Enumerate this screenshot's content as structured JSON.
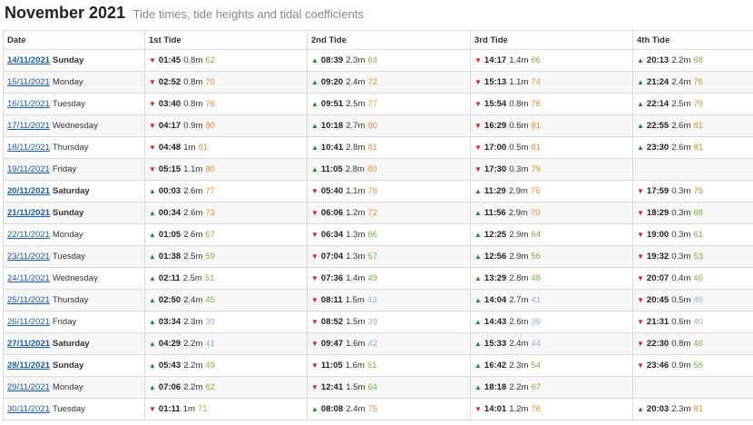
{
  "title": "November 2021",
  "subtitle": "Tide times, tide heights and tidal coefficients",
  "columns": [
    "Date",
    "1st Tide",
    "2nd Tide",
    "3rd Tide",
    "4th Tide"
  ],
  "colors": {
    "coef_high": "#7cb342",
    "coef_mid": "#e69138",
    "coef_low": "#8fb3d9",
    "up": "#1b8a2f",
    "down": "#d42020",
    "link": "#1a5fa8"
  },
  "rows": [
    {
      "date": "14/11/2021",
      "weekday": "Sunday",
      "bold": true,
      "tides": [
        {
          "dir": "down",
          "time": "01:45",
          "height": "0.8m",
          "coef": "62"
        },
        {
          "dir": "up",
          "time": "08:39",
          "height": "2.3m",
          "coef": "64"
        },
        {
          "dir": "down",
          "time": "14:17",
          "height": "1.4m",
          "coef": "66"
        },
        {
          "dir": "up",
          "time": "20:13",
          "height": "2.2m",
          "coef": "68"
        }
      ]
    },
    {
      "date": "15/11/2021",
      "weekday": "Monday",
      "bold": false,
      "tides": [
        {
          "dir": "down",
          "time": "02:52",
          "height": "0.8m",
          "coef": "70"
        },
        {
          "dir": "up",
          "time": "09:20",
          "height": "2.4m",
          "coef": "72"
        },
        {
          "dir": "down",
          "time": "15:13",
          "height": "1.1m",
          "coef": "74"
        },
        {
          "dir": "up",
          "time": "21:24",
          "height": "2.4m",
          "coef": "75"
        }
      ]
    },
    {
      "date": "16/11/2021",
      "weekday": "Tuesday",
      "bold": false,
      "tides": [
        {
          "dir": "down",
          "time": "03:40",
          "height": "0.8m",
          "coef": "76"
        },
        {
          "dir": "up",
          "time": "09:51",
          "height": "2.5m",
          "coef": "77"
        },
        {
          "dir": "down",
          "time": "15:54",
          "height": "0.8m",
          "coef": "78"
        },
        {
          "dir": "up",
          "time": "22:14",
          "height": "2.5m",
          "coef": "79"
        }
      ]
    },
    {
      "date": "17/11/2021",
      "weekday": "Wednesday",
      "bold": false,
      "tides": [
        {
          "dir": "down",
          "time": "04:17",
          "height": "0.9m",
          "coef": "80"
        },
        {
          "dir": "up",
          "time": "10:18",
          "height": "2.7m",
          "coef": "80"
        },
        {
          "dir": "down",
          "time": "16:29",
          "height": "0.6m",
          "coef": "81"
        },
        {
          "dir": "up",
          "time": "22:55",
          "height": "2.6m",
          "coef": "81"
        }
      ]
    },
    {
      "date": "18/11/2021",
      "weekday": "Thursday",
      "bold": false,
      "tides": [
        {
          "dir": "down",
          "time": "04:48",
          "height": "1m",
          "coef": "81"
        },
        {
          "dir": "up",
          "time": "10:41",
          "height": "2.8m",
          "coef": "81"
        },
        {
          "dir": "down",
          "time": "17:00",
          "height": "0.5m",
          "coef": "81"
        },
        {
          "dir": "up",
          "time": "23:30",
          "height": "2.6m",
          "coef": "81"
        }
      ]
    },
    {
      "date": "19/11/2021",
      "weekday": "Friday",
      "bold": false,
      "tides": [
        {
          "dir": "down",
          "time": "05:15",
          "height": "1.1m",
          "coef": "80"
        },
        {
          "dir": "up",
          "time": "11:05",
          "height": "2.8m",
          "coef": "80"
        },
        {
          "dir": "down",
          "time": "17:30",
          "height": "0.3m",
          "coef": "79"
        },
        null
      ]
    },
    {
      "date": "20/11/2021",
      "weekday": "Saturday",
      "bold": true,
      "tides": [
        {
          "dir": "up",
          "time": "00:03",
          "height": "2.6m",
          "coef": "77"
        },
        {
          "dir": "down",
          "time": "05:40",
          "height": "1.1m",
          "coef": "76"
        },
        {
          "dir": "up",
          "time": "11:29",
          "height": "2.9m",
          "coef": "76"
        },
        {
          "dir": "down",
          "time": "17:59",
          "height": "0.3m",
          "coef": "75"
        }
      ]
    },
    {
      "date": "21/11/2021",
      "weekday": "Sunday",
      "bold": true,
      "tides": [
        {
          "dir": "up",
          "time": "00:34",
          "height": "2.6m",
          "coef": "73"
        },
        {
          "dir": "down",
          "time": "06:06",
          "height": "1.2m",
          "coef": "72"
        },
        {
          "dir": "up",
          "time": "11:56",
          "height": "2.9m",
          "coef": "70"
        },
        {
          "dir": "down",
          "time": "18:29",
          "height": "0.3m",
          "coef": "68"
        }
      ]
    },
    {
      "date": "22/11/2021",
      "weekday": "Monday",
      "bold": false,
      "tides": [
        {
          "dir": "up",
          "time": "01:05",
          "height": "2.6m",
          "coef": "67"
        },
        {
          "dir": "down",
          "time": "06:34",
          "height": "1.3m",
          "coef": "66"
        },
        {
          "dir": "up",
          "time": "12:25",
          "height": "2.9m",
          "coef": "64"
        },
        {
          "dir": "down",
          "time": "19:00",
          "height": "0.3m",
          "coef": "61"
        }
      ]
    },
    {
      "date": "23/11/2021",
      "weekday": "Tuesday",
      "bold": false,
      "tides": [
        {
          "dir": "up",
          "time": "01:38",
          "height": "2.5m",
          "coef": "59"
        },
        {
          "dir": "down",
          "time": "07:04",
          "height": "1.3m",
          "coef": "57"
        },
        {
          "dir": "up",
          "time": "12:56",
          "height": "2.9m",
          "coef": "56"
        },
        {
          "dir": "down",
          "time": "19:32",
          "height": "0.3m",
          "coef": "53"
        }
      ]
    },
    {
      "date": "24/11/2021",
      "weekday": "Wednesday",
      "bold": false,
      "tides": [
        {
          "dir": "up",
          "time": "02:11",
          "height": "2.5m",
          "coef": "51"
        },
        {
          "dir": "down",
          "time": "07:36",
          "height": "1.4m",
          "coef": "49"
        },
        {
          "dir": "up",
          "time": "13:29",
          "height": "2.8m",
          "coef": "48"
        },
        {
          "dir": "down",
          "time": "20:07",
          "height": "0.4m",
          "coef": "46"
        }
      ]
    },
    {
      "date": "25/11/2021",
      "weekday": "Thursday",
      "bold": false,
      "tides": [
        {
          "dir": "up",
          "time": "02:50",
          "height": "2.4m",
          "coef": "45"
        },
        {
          "dir": "down",
          "time": "08:11",
          "height": "1.5m",
          "coef": "43"
        },
        {
          "dir": "up",
          "time": "14:04",
          "height": "2.7m",
          "coef": "41"
        },
        {
          "dir": "down",
          "time": "20:45",
          "height": "0.5m",
          "coef": "40"
        }
      ]
    },
    {
      "date": "26/11/2021",
      "weekday": "Friday",
      "bold": false,
      "tides": [
        {
          "dir": "up",
          "time": "03:34",
          "height": "2.3m",
          "coef": "39"
        },
        {
          "dir": "down",
          "time": "08:52",
          "height": "1.5m",
          "coef": "39"
        },
        {
          "dir": "up",
          "time": "14:43",
          "height": "2.6m",
          "coef": "39"
        },
        {
          "dir": "down",
          "time": "21:31",
          "height": "0.6m",
          "coef": "40"
        }
      ]
    },
    {
      "date": "27/11/2021",
      "weekday": "Saturday",
      "bold": true,
      "tides": [
        {
          "dir": "up",
          "time": "04:29",
          "height": "2.2m",
          "coef": "41"
        },
        {
          "dir": "down",
          "time": "09:47",
          "height": "1.6m",
          "coef": "42"
        },
        {
          "dir": "up",
          "time": "15:33",
          "height": "2.4m",
          "coef": "44"
        },
        {
          "dir": "down",
          "time": "22:30",
          "height": "0.8m",
          "coef": "46"
        }
      ]
    },
    {
      "date": "28/11/2021",
      "weekday": "Sunday",
      "bold": true,
      "tides": [
        {
          "dir": "up",
          "time": "05:43",
          "height": "2.2m",
          "coef": "49"
        },
        {
          "dir": "down",
          "time": "11:05",
          "height": "1.6m",
          "coef": "51"
        },
        {
          "dir": "up",
          "time": "16:42",
          "height": "2.3m",
          "coef": "54"
        },
        {
          "dir": "down",
          "time": "23:46",
          "height": "0.9m",
          "coef": "58"
        }
      ]
    },
    {
      "date": "29/11/2021",
      "weekday": "Monday",
      "bold": false,
      "tides": [
        {
          "dir": "up",
          "time": "07:06",
          "height": "2.2m",
          "coef": "62"
        },
        {
          "dir": "down",
          "time": "12:41",
          "height": "1.5m",
          "coef": "64"
        },
        {
          "dir": "up",
          "time": "18:18",
          "height": "2.2m",
          "coef": "67"
        },
        null
      ]
    },
    {
      "date": "30/11/2021",
      "weekday": "Tuesday",
      "bold": false,
      "tides": [
        {
          "dir": "down",
          "time": "01:11",
          "height": "1m",
          "coef": "71"
        },
        {
          "dir": "up",
          "time": "08:08",
          "height": "2.4m",
          "coef": "75"
        },
        {
          "dir": "down",
          "time": "14:01",
          "height": "1.2m",
          "coef": "78"
        },
        {
          "dir": "up",
          "time": "20:03",
          "height": "2.3m",
          "coef": "81"
        }
      ]
    }
  ]
}
